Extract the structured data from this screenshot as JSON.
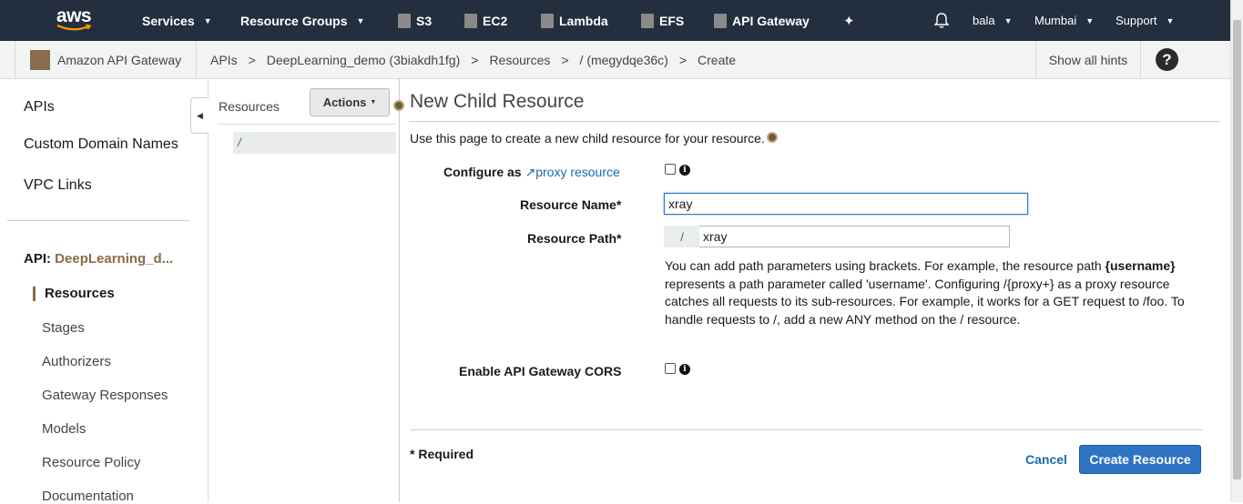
{
  "nav": {
    "logo_text": "aws",
    "services": "Services",
    "resource_groups": "Resource Groups",
    "shortcuts": [
      {
        "label": "S3",
        "icon": "s3-icon",
        "color": "#c7511f"
      },
      {
        "label": "EC2",
        "icon": "ec2-icon",
        "color": "#c7511f"
      },
      {
        "label": "Lambda",
        "icon": "lambda-icon",
        "color": "#c7511f"
      },
      {
        "label": "EFS",
        "icon": "efs-icon",
        "color": "#c7511f"
      },
      {
        "label": "API Gateway",
        "icon": "api-gateway-icon",
        "color": "#a0744a"
      }
    ],
    "user": "bala",
    "region": "Mumbai",
    "support": "Support"
  },
  "breadcrumb": {
    "service": "Amazon API Gateway",
    "items": [
      "APIs",
      "DeepLearning_demo (3biakdh1fg)",
      "Resources",
      "/ (megydqe36c)",
      "Create"
    ],
    "separator": ">",
    "hints": "Show all hints"
  },
  "sidebar": {
    "links": [
      "APIs",
      "Custom Domain Names",
      "VPC Links"
    ],
    "api_prefix": "API:",
    "api_name": "DeepLearning_d...",
    "active": "Resources",
    "items": [
      "Stages",
      "Authorizers",
      "Gateway Responses",
      "Models",
      "Resource Policy",
      "Documentation"
    ]
  },
  "resources_panel": {
    "title": "Resources",
    "actions": "Actions",
    "root": "/"
  },
  "form": {
    "title": "New Child Resource",
    "intro": "Use this page to create a new child resource for your resource.",
    "configure_label": "Configure as",
    "proxy_link": "proxy resource",
    "name_label": "Resource Name*",
    "name_value": "xray",
    "path_label": "Resource Path*",
    "path_prefix": "/",
    "path_value": "xray",
    "help_parts": {
      "a": "You can add path parameters using brackets. For example, the resource path ",
      "b": "{username}",
      "c": " represents a path parameter called 'username'. Configuring /{proxy+} as a proxy resource catches all requests to its sub-resources. For example, it works for a GET request to /foo. To handle requests to /, add a new ANY method on the / resource."
    },
    "cors_label": "Enable API Gateway CORS",
    "required_note": "* Required",
    "cancel": "Cancel",
    "submit": "Create Resource"
  },
  "colors": {
    "nav_bg": "#232f3e",
    "primary": "#2f73c3",
    "link": "#1a6aa8",
    "api_accent": "#8a6b4a"
  }
}
